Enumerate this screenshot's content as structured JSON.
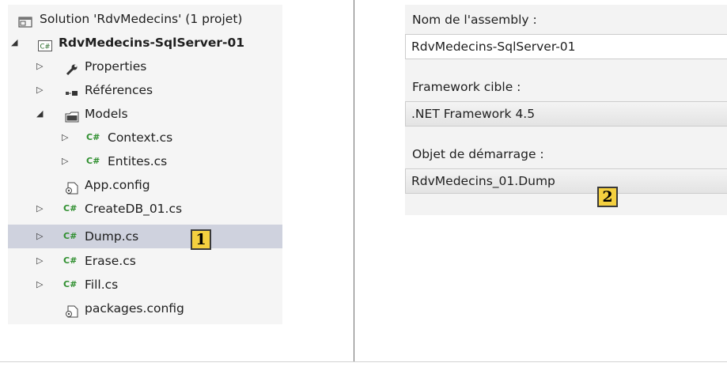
{
  "solution_explorer": {
    "items": [
      {
        "label": "Solution 'RdvMedecins' (1 projet)",
        "expander": "",
        "icon": "solution-icon"
      },
      {
        "label": "RdvMedecins-SqlServer-01",
        "expander": "◢",
        "icon": "csharp-project-icon",
        "bold": true
      },
      {
        "label": "Properties",
        "expander": "▷",
        "icon": "wrench-icon"
      },
      {
        "label": "Références",
        "expander": "▷",
        "icon": "references-icon"
      },
      {
        "label": "Models",
        "expander": "◢",
        "icon": "folder-icon"
      },
      {
        "label": "Context.cs",
        "expander": "▷",
        "icon": "csharp-file-icon",
        "badge": "C#"
      },
      {
        "label": "Entites.cs",
        "expander": "▷",
        "icon": "csharp-file-icon",
        "badge": "C#"
      },
      {
        "label": "App.config",
        "expander": "",
        "icon": "config-file-icon"
      },
      {
        "label": "CreateDB_01.cs",
        "expander": "▷",
        "icon": "csharp-file-icon",
        "badge": "C#"
      },
      {
        "label": "Dump.cs",
        "expander": "▷",
        "icon": "csharp-file-icon",
        "badge": "C#",
        "selected": true
      },
      {
        "label": "Erase.cs",
        "expander": "▷",
        "icon": "csharp-file-icon",
        "badge": "C#"
      },
      {
        "label": "Fill.cs",
        "expander": "▷",
        "icon": "csharp-file-icon",
        "badge": "C#"
      },
      {
        "label": "packages.config",
        "expander": "",
        "icon": "config-file-icon"
      }
    ],
    "callout": "1"
  },
  "properties": {
    "assembly_label": "Nom de l'assembly :",
    "assembly_value": "RdvMedecins-SqlServer-01",
    "framework_label": "Framework cible :",
    "framework_value": ".NET Framework 4.5",
    "startup_label": "Objet de démarrage :",
    "startup_value": "RdvMedecins_01.Dump",
    "callout": "2"
  },
  "colors": {
    "selection": "#cfd2de",
    "csharp_green": "#2f8f2f",
    "callout_fill": "#f4d03f"
  }
}
